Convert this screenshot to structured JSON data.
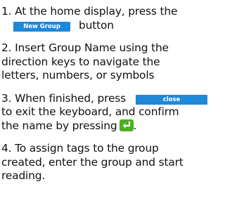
{
  "instructions": {
    "step1": {
      "text_before": "1. At the home display, press the",
      "button_label": "New Group",
      "text_after": "button"
    },
    "step2": {
      "line1": "2. Insert Group Name using the",
      "line2": "direction keys to navigate the",
      "line3": "letters, numbers, or symbols"
    },
    "step3": {
      "text_before": "3. When finished, press",
      "button_label": "close",
      "line2": "to exit the keyboard, and confirm",
      "text_before_key": "the name by pressing",
      "text_after_key": "."
    },
    "step4": {
      "line1": "4. To assign tags to the group",
      "line2": "created, enter the group and start",
      "line3": "reading."
    }
  },
  "colors": {
    "button_blue": "#1e88d9",
    "enter_key_green": "#4caf23"
  },
  "icons": {
    "enter_key": "enter-key-icon"
  }
}
